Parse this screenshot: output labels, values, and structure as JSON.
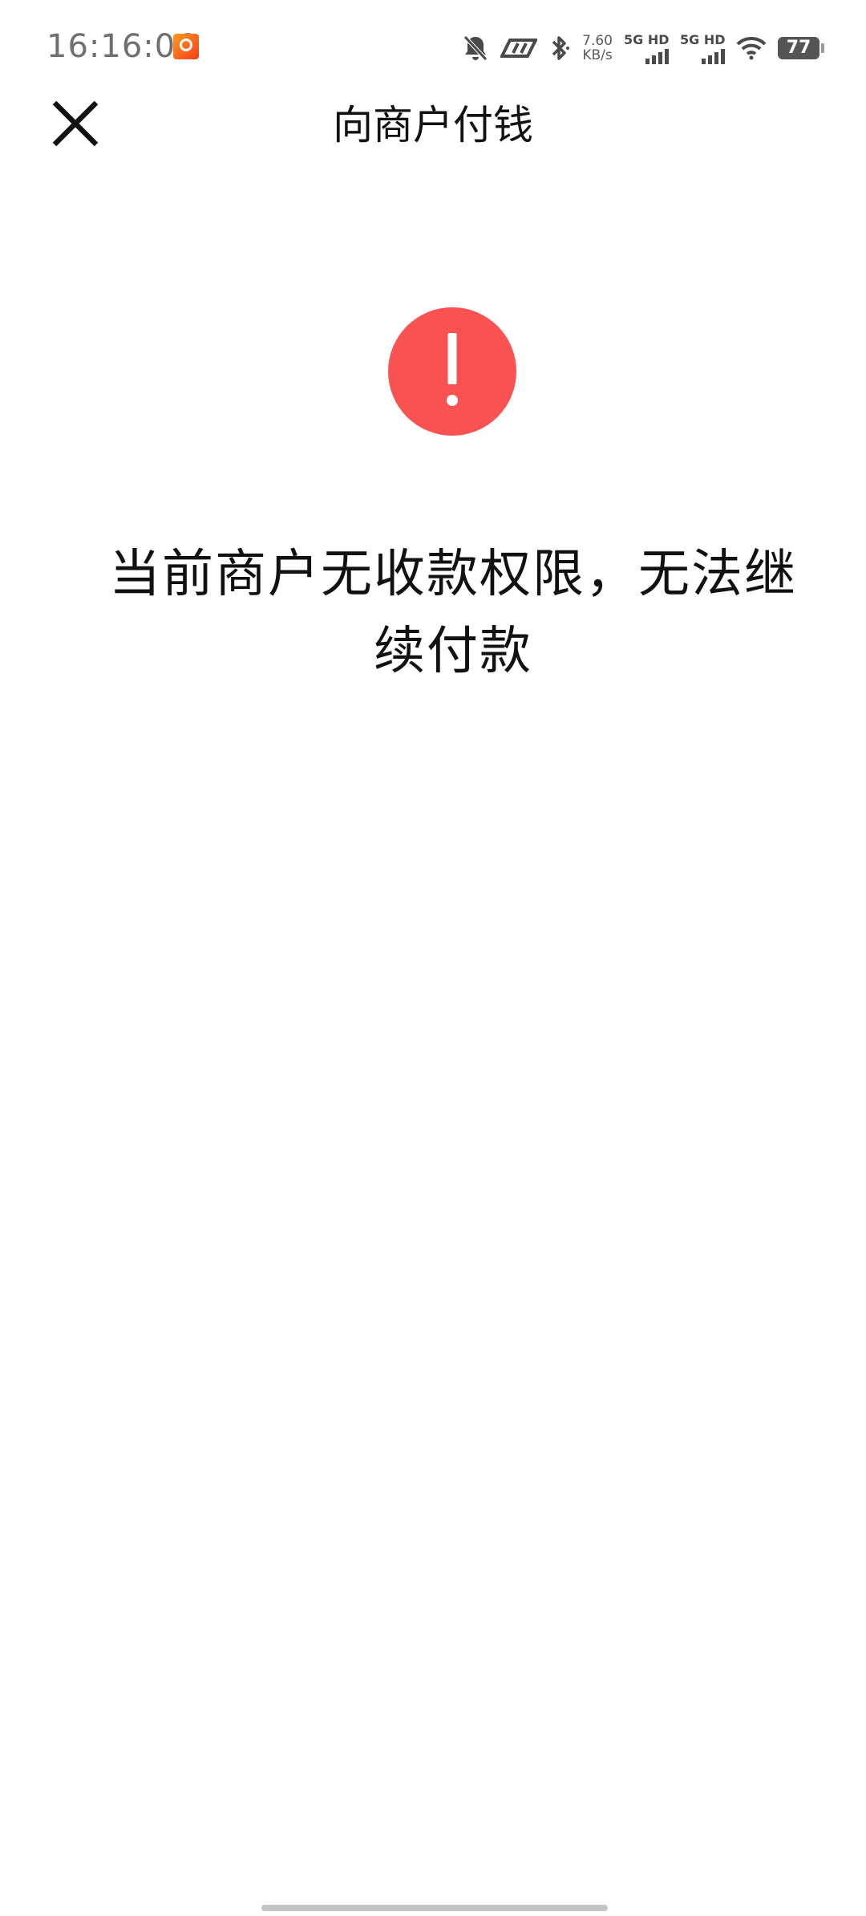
{
  "status_bar": {
    "time": "16:16:06",
    "net_speed_value": "7.60",
    "net_speed_unit": "KB/s",
    "sim1_label": "5G HD",
    "sim2_label": "5G HD",
    "battery_level": "77",
    "icons": [
      "app-notification-icon",
      "mute-icon",
      "nfc-icon",
      "bluetooth-icon",
      "signal-icon",
      "wifi-icon",
      "battery-icon"
    ]
  },
  "header": {
    "title": "向商户付钱",
    "close_icon": "close-icon"
  },
  "error": {
    "icon": "exclamation-icon",
    "icon_color": "#fa5151",
    "message": "当前商户无收款权限，无法继续付款"
  }
}
